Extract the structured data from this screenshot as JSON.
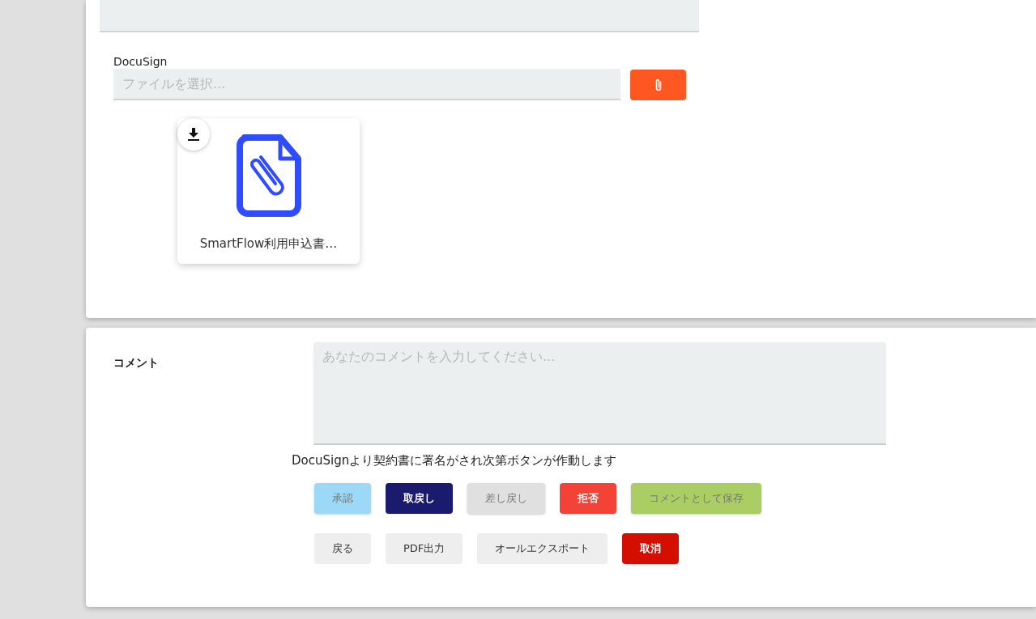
{
  "upload": {
    "label": "DocuSign",
    "placeholder": "ファイルを選択..."
  },
  "files": [
    {
      "name": "SmartFlow利用申込書…"
    }
  ],
  "comment": {
    "label": "コメント",
    "placeholder": "あなたのコメントを入力してください...",
    "note": "DocuSignより契約書に署名がされ次第ボタンが作動します"
  },
  "button_rows": [
    [
      {
        "label": "承認",
        "color": "#9bd9f7",
        "disabled": true
      },
      {
        "label": "取戻し",
        "color": "#1a1a6e",
        "disabled": false
      },
      {
        "label": "差し戻し",
        "color": "#e0e0e0",
        "disabled": true
      },
      {
        "label": "拒否",
        "color": "#f44336",
        "disabled": false
      },
      {
        "label": "コメントとして保存",
        "color": "#aacd64",
        "disabled": true
      }
    ],
    [
      {
        "label": "戻る",
        "color": "#eeeeee",
        "disabled": false
      },
      {
        "label": "PDF出力",
        "color": "#eeeeee",
        "disabled": false
      },
      {
        "label": "オールエクスポート",
        "color": "#eeeeee",
        "disabled": false
      },
      {
        "label": "取消",
        "color": "#d50f00",
        "disabled": false
      }
    ]
  ]
}
